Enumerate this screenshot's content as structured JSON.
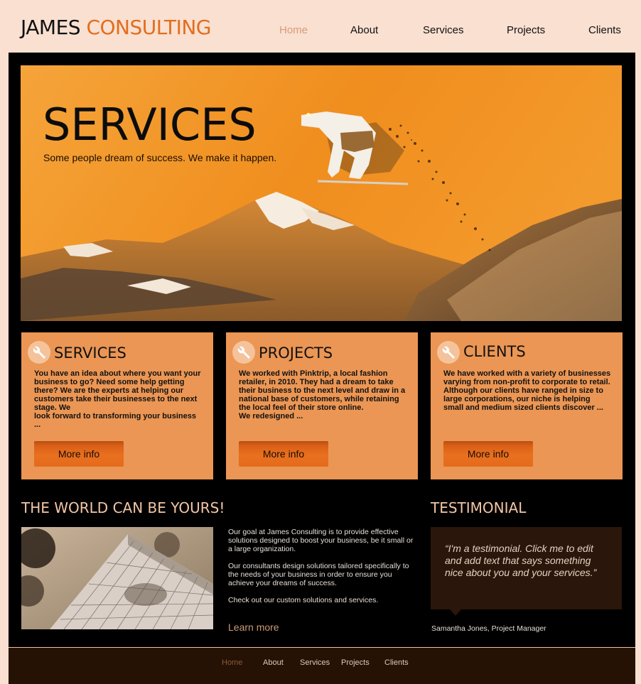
{
  "brand": {
    "first": "JAMES",
    "second": "CONSULTING"
  },
  "nav": {
    "home": "Home",
    "about": "About",
    "services": "Services",
    "projects": "Projects",
    "clients": "Clients"
  },
  "hero": {
    "title": "SERVICES",
    "subtitle": "Some people dream of success. We make it happen."
  },
  "boxes": [
    {
      "title": "SERVICES",
      "text": "You have an idea about where you want your business to go? Need some help getting there? We are the experts at helping our customers take their businesses to the next stage. We\n look forward to transforming your business ...",
      "button": "More info"
    },
    {
      "title": "PROJECTS",
      "text": "We worked with Pinktrip, a local fashion retailer, in 2010. They had a dream to take their business to the next level and draw in a national base of customers, while retaining the local feel of their store online.\nWe redesigned ...",
      "button": "More info"
    },
    {
      "title": "CLIENTS",
      "text": "We have worked with a variety of businesses varying from non-profit to corporate to retail. Although our clients have ranged in size to large corporations, our niche is helping small and medium sized clients discover  ...",
      "button": "More info"
    }
  ],
  "world": {
    "title": "THE WORLD CAN BE YOURS!",
    "p1": "Our goal at James Consulting is to provide effective solutions designed to boost your business, be it small or a large organization.",
    "p2": "Our consultants design solutions tailored specifically to the needs of your business in order to ensure you achieve your dreams of success.",
    "p3": "Check out our custom solutions and services.",
    "link": "Learn more"
  },
  "testimonial": {
    "title": "TESTIMONIAL",
    "quote": "“I'm a testimonial. Click me to edit and add text that says something nice about you and your services.”",
    "author": "Samantha Jones, Project Manager"
  },
  "footer_nav": {
    "home": "Home",
    "about": "About",
    "services": "Services",
    "projects": "Projects",
    "clients": "Clients"
  },
  "colors": {
    "accent": "#e36d1c",
    "box": "#eb9654",
    "page_bg": "#f9e0d1",
    "active_nav_header": "#d99b77",
    "active_nav_footer": "#8a5a3c"
  },
  "icons": {
    "box_icon": "wrench-icon"
  }
}
